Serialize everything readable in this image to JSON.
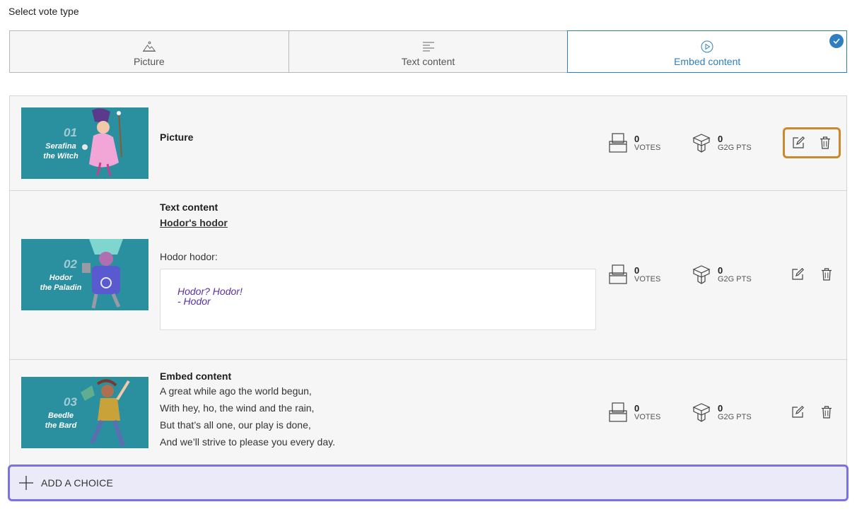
{
  "page": {
    "heading": "Select vote type"
  },
  "vote_types": [
    {
      "label": "Picture",
      "icon": "picture-icon",
      "selected": false
    },
    {
      "label": "Text content",
      "icon": "text-lines-icon",
      "selected": false
    },
    {
      "label": "Embed content",
      "icon": "play-circle-icon",
      "selected": true
    }
  ],
  "choices": [
    {
      "number": "01",
      "character": [
        "Serafina",
        "the Witch"
      ],
      "title": "Picture",
      "votes": "0",
      "votes_label": "VOTES",
      "points": "0",
      "points_label": "G2G PTS"
    },
    {
      "number": "02",
      "character": [
        "Hodor",
        "the Paladin"
      ],
      "title": "Text content",
      "subtitle": "Hodor's hodor",
      "body": "Hodor hodor:",
      "quote": "Hodor? Hodor!\n- Hodor",
      "votes": "0",
      "votes_label": "VOTES",
      "points": "0",
      "points_label": "G2G PTS"
    },
    {
      "number": "03",
      "character": [
        "Beedle",
        "the Bard"
      ],
      "title": "Embed content",
      "poem": "A great while ago the world begun,\nWith hey, ho, the wind and the rain,\nBut that’s all one, our play is done,\nAnd we’ll strive to please you every day.",
      "votes": "0",
      "votes_label": "VOTES",
      "points": "0",
      "points_label": "G2G PTS"
    }
  ],
  "add_choice": {
    "label": "ADD A CHOICE"
  },
  "colors": {
    "accent": "#2f7fc0",
    "thumb_bg": "#2a8f9f",
    "highlight": "#c98a2b",
    "add_border": "#7b70e6",
    "quote_text": "#5a2fa8"
  }
}
